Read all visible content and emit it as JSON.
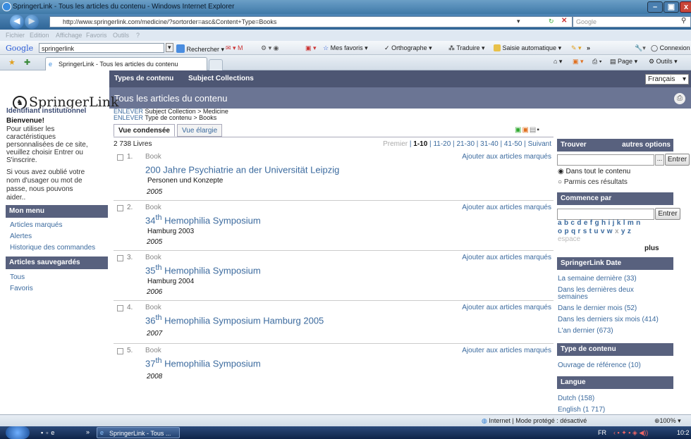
{
  "window": {
    "title": "SpringerLink - Tous les articles du contenu - Windows Internet Explorer"
  },
  "address": {
    "url": "http://www.springerlink.com/medicine/?sortorder=asc&Content+Type=Books",
    "search_placeholder": "Google"
  },
  "menu": [
    "Fichier",
    "Edition",
    "Affichage",
    "Favoris",
    "Outils",
    "?"
  ],
  "googlebar": {
    "logo": "Google",
    "query": "springerlink",
    "search": "Rechercher",
    "favorites": "Mes favoris",
    "spell": "Orthographe",
    "translate": "Traduire",
    "autofill": "Saisie automatique",
    "more": "»",
    "signin": "Connexion"
  },
  "browser_tab": {
    "title": "SpringerLink - Tous les articles du contenu",
    "page_menu": "Page",
    "tools_menu": "Outils"
  },
  "site": {
    "nav": [
      "Types de contenu",
      "Subject Collections"
    ],
    "language": "Français",
    "logo": "SpringerLink",
    "page_title": "Tous les articles du contenu"
  },
  "left": {
    "institution": "Identifiant institutionnel",
    "welcome": "Bienvenue!",
    "welcome_lines": [
      "Pour utiliser les",
      "caractéristiques",
      "personnalisées de ce site,",
      "veuillez choisir Entrer ou",
      "S'inscrire."
    ],
    "forgot_lines": [
      "Si vous avez oublié votre",
      "nom d'usager ou mot de",
      "passe, nous pouvons",
      "aider.."
    ],
    "my_menu": "Mon menu",
    "my_menu_items": [
      "Articles marqués",
      "Alertes",
      "Historique des commandes"
    ],
    "saved": "Articles sauvegardés",
    "saved_items": [
      "Tous",
      "Favoris"
    ]
  },
  "breadcrumbs": [
    {
      "remove": "ENLEVER",
      "text": "Subject Collection > Medicine"
    },
    {
      "remove": "ENLEVER",
      "text": "Type de contenu > Books"
    }
  ],
  "views": {
    "condensed": "Vue condensée",
    "expanded": "Vue élargie"
  },
  "results": {
    "count": "2 738 Livres",
    "first": "Premier",
    "pages": [
      "1-10",
      "11-20",
      "21-30",
      "31-40",
      "41-50"
    ],
    "next": "Suivant"
  },
  "items": [
    {
      "num": "1.",
      "kind": "Book",
      "title": "200 Jahre Psychiatrie an der Universität Leipzig",
      "sup": "",
      "title_rest": "",
      "subtitle": "Personen und Konzepte",
      "year": "2005",
      "add": "Ajouter aux articles marqués"
    },
    {
      "num": "2.",
      "kind": "Book",
      "title": "34",
      "sup": "th",
      "title_rest": " Hemophilia Symposium",
      "subtitle": "Hamburg 2003",
      "year": "2005",
      "add": "Ajouter aux articles marqués"
    },
    {
      "num": "3.",
      "kind": "Book",
      "title": "35",
      "sup": "th",
      "title_rest": " Hemophilia Symposium",
      "subtitle": "Hamburg 2004",
      "year": "2006",
      "add": "Ajouter aux articles marqués"
    },
    {
      "num": "4.",
      "kind": "Book",
      "title": "36",
      "sup": "th",
      "title_rest": " Hemophilia Symposium Hamburg 2005",
      "subtitle": "",
      "year": "2007",
      "add": "Ajouter aux articles marqués"
    },
    {
      "num": "5.",
      "kind": "Book",
      "title": "37",
      "sup": "th",
      "title_rest": " Hemophilia Symposium",
      "subtitle": "",
      "year": "2008",
      "add": "Ajouter aux articles marqués"
    }
  ],
  "right": {
    "find": "Trouver",
    "more_options": "autres options",
    "find_btn": "Entrer",
    "ellipsis": "...",
    "scope_all": "Dans tout le contenu",
    "scope_results": "Parmis ces résultats",
    "starts_with": "Commence par",
    "starts_btn": "Entrer",
    "letters1": "a b c d e f g h i j k l m n",
    "letters2a": "o p q r s t u v w",
    "letters2b": " x ",
    "letters2c": "y z",
    "space": "espace",
    "plus": "plus",
    "date_head": "SpringerLink Date",
    "dates": [
      "La semaine dernière (33)",
      "Dans les dernières deux",
      "semaines",
      "Dans le dernier mois (52)",
      "Dans les derniers six mois (414)",
      "L'an dernier (673)"
    ],
    "type_head": "Type de contenu",
    "types": [
      "Ouvrage de référence (10)"
    ],
    "lang_head": "Langue",
    "langs": [
      "Dutch (158)",
      "English (1 717)"
    ]
  },
  "status": {
    "zone": "Internet | Mode protégé : désactivé",
    "zoom": "100%"
  },
  "taskbar": {
    "task": "SpringerLink - Tous ...",
    "lang": "FR",
    "time": "10:2",
    "more": "»"
  },
  "colors": {
    "band": "#6b7594",
    "strip": "#4d5673",
    "sidehead": "#58617e",
    "link": "#3b6a9e"
  }
}
